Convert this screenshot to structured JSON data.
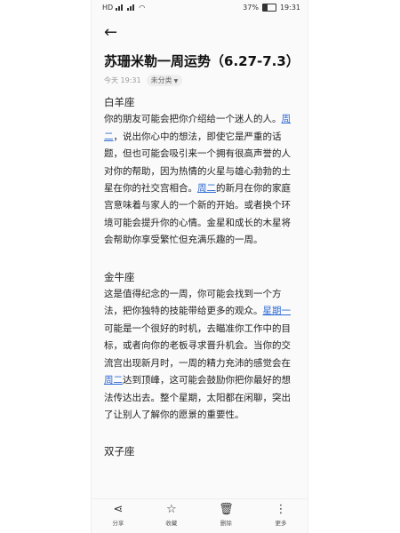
{
  "status": {
    "carrier_left": "HD",
    "battery_percent": "37%",
    "battery_level": 0.37,
    "time": "19:31"
  },
  "icons": {
    "back": "arrow-left-icon",
    "share": "share-icon",
    "favorite": "star-icon",
    "delete": "trash-icon",
    "more": "more-dots-icon"
  },
  "article": {
    "title": "苏珊米勒一周运势（6.27-7.3）",
    "date": "今天 19:31",
    "category": "未分类"
  },
  "sections": [
    {
      "heading": "白羊座",
      "parts": [
        "你的朋友可能会把你介绍给一个迷人的人。",
        "周二",
        "，说出你心中的想法，即使它是严重的话题，但也可能会吸引来一个拥有很高声誉的人对你的帮助，因为热情的火星与雄心勃勃的土星在你的社交宫相合。",
        "周二",
        "的新月在你的家庭宫意味着与家人的一个新的开始。或者换个环境可能会提升你的心情。金星和成长的木星将会帮助你享受繁忙但充满乐趣的一周。"
      ]
    },
    {
      "heading": "金牛座",
      "parts": [
        "这是值得纪念的一周，你可能会找到一个方法，把你独特的技能带给更多的观众。",
        "星期一",
        "可能是一个很好的时机，去瞄准你工作中的目标，或者向你的老板寻求晋升机会。当你的交流宫出现新月时，一周的精力充沛的感觉会在",
        "周二",
        "达到顶峰，这可能会鼓励你把你最好的想法传达出去。整个星期，太阳都在闲聊，突出了让别人了解你的愿景的重要性。"
      ]
    },
    {
      "heading": "双子座"
    }
  ],
  "toolbar": {
    "share": "分享",
    "favorite": "收藏",
    "delete": "删除",
    "more": "更多"
  }
}
